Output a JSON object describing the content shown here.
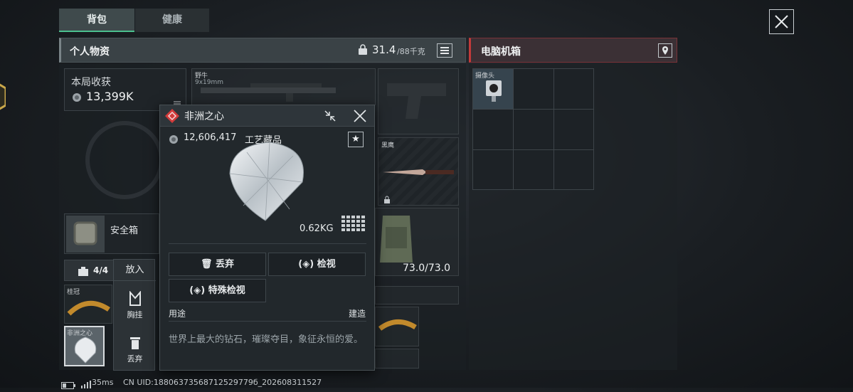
{
  "tabs": [
    {
      "label": "背包",
      "active": true
    },
    {
      "label": "健康",
      "active": false
    }
  ],
  "personal": {
    "title": "个人物资",
    "weight": "31.4",
    "capacity": "/88千克",
    "lock_icon": "weight-icon",
    "list_icon": "list-icon"
  },
  "earnings": {
    "label": "本局收获",
    "value": "13,399K",
    "icon": "coin-icon"
  },
  "weapons": {
    "main_name": "野牛",
    "main_caliber": "9x19mm",
    "knife_name": "黑鹰"
  },
  "armor": {
    "durability": "73.0/73.0"
  },
  "safe_box": {
    "label": "安全箱"
  },
  "case_bar": {
    "count": "4/4"
  },
  "case_items": [
    {
      "label": "桂冠"
    },
    {
      "label": "非洲之心"
    }
  ],
  "context_menu": {
    "header": "放入",
    "chest_label": "胸挂",
    "discard_label": "丢弃"
  },
  "popup": {
    "title": "非洲之心",
    "price": "12,606,417",
    "category": "工艺藏品",
    "weight": "0.62KG",
    "discard_btn": "丢弃",
    "inspect_btn": "检视",
    "special_inspect_btn": "特殊检视",
    "usage_label": "用途",
    "build_label": "建造",
    "description": "世界上最大的钻石，璀璨夺目，象征永恒的爱。"
  },
  "computer_box": {
    "title": "电脑机箱",
    "item_label": "摄像头"
  },
  "status_bar": {
    "ping": "35ms",
    "uid": "CN UID:18806373568712529779б_202608311527"
  },
  "colors": {
    "accent_green": "#4bbf8e",
    "box_red": "#c23a3a",
    "diamond_badge": "#d23b3b"
  }
}
